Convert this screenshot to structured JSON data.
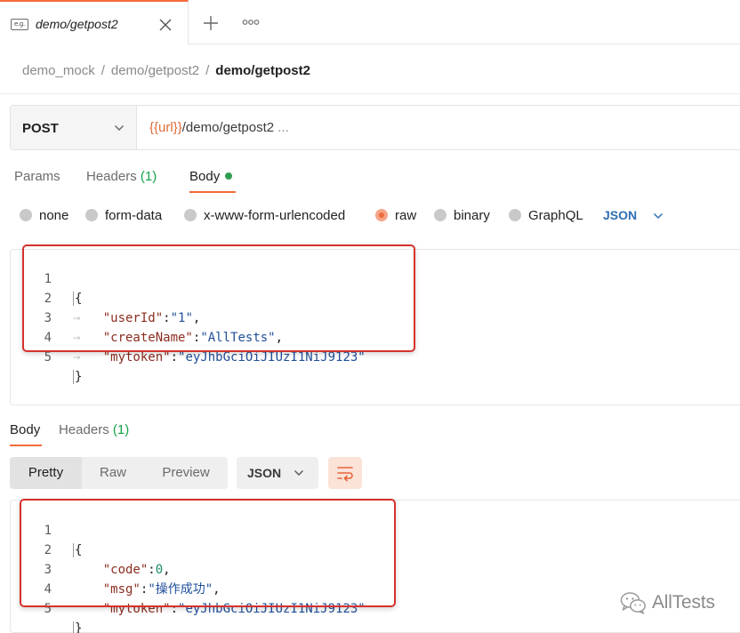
{
  "tab": {
    "badge": "e.g.",
    "title": "demo/getpost2"
  },
  "breadcrumb": {
    "items": [
      "demo_mock",
      "demo/getpost2"
    ],
    "separator": "/",
    "current": "demo/getpost2"
  },
  "request": {
    "method": "POST",
    "url_variable": "{{url}}",
    "url_path": "/demo/getpost2",
    "url_more": " ..."
  },
  "request_tabs": {
    "params": "Params",
    "headers": "Headers",
    "headers_count": "(1)",
    "body": "Body"
  },
  "body_types": {
    "options": [
      "none",
      "form-data",
      "x-www-form-urlencoded",
      "raw",
      "binary",
      "GraphQL"
    ],
    "selected": "raw",
    "format": "JSON"
  },
  "request_body": {
    "line_numbers": [
      "1",
      "2",
      "3",
      "4",
      "5"
    ],
    "open": "{",
    "close": "}",
    "fields": [
      {
        "key": "\"userId\"",
        "colon": ":",
        "value": "\"1\"",
        "comma": ","
      },
      {
        "key": "\"createName\"",
        "colon": ":",
        "value": "\"AllTests\"",
        "comma": ","
      },
      {
        "key": "\"mytoken\"",
        "colon": ":",
        "value": "\"eyJhbGciOiJIUzI1NiJ9123\"",
        "comma": ""
      }
    ]
  },
  "response_tabs": {
    "body": "Body",
    "headers": "Headers",
    "headers_count": "(1)"
  },
  "response_view": {
    "modes": [
      "Pretty",
      "Raw",
      "Preview"
    ],
    "selected": "Pretty",
    "format": "JSON"
  },
  "response_body": {
    "line_numbers": [
      "1",
      "2",
      "3",
      "4",
      "5"
    ],
    "open": "{",
    "close": "}",
    "fields": [
      {
        "key": "\"code\"",
        "colon": ":",
        "value": "0",
        "comma": ","
      },
      {
        "key": "\"msg\"",
        "colon": ":",
        "value": "\"操作成功\"",
        "comma": ","
      },
      {
        "key": "\"mytoken\"",
        "colon": ":",
        "value": "\"eyJhbGciOiJIUzI1NiJ9123\"",
        "comma": ""
      }
    ]
  },
  "watermark": {
    "text": "AllTests"
  },
  "colors": {
    "accent": "#f26b3a",
    "highlight_box": "#d6312c",
    "json_key": "#8b2d1f",
    "json_string": "#1f4f9a",
    "json_number": "#1b8a6b",
    "active_dot": "#2e9e4e",
    "count_green": "#16a34a"
  }
}
